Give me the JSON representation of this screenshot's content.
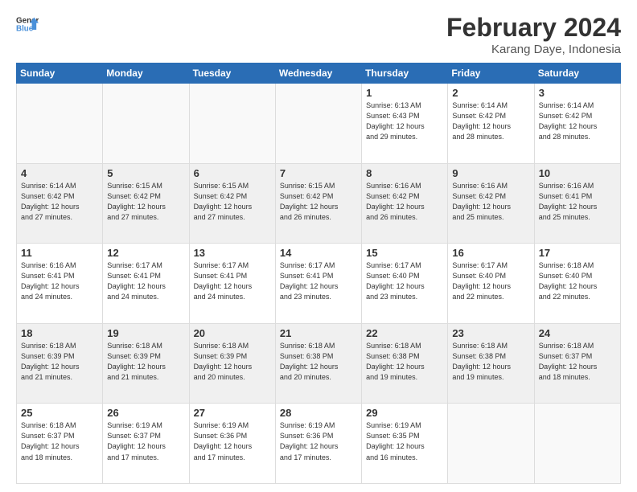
{
  "header": {
    "logo_general": "General",
    "logo_blue": "Blue",
    "month": "February 2024",
    "location": "Karang Daye, Indonesia"
  },
  "weekdays": [
    "Sunday",
    "Monday",
    "Tuesday",
    "Wednesday",
    "Thursday",
    "Friday",
    "Saturday"
  ],
  "rows": [
    {
      "shaded": false,
      "cells": [
        {
          "num": "",
          "info": ""
        },
        {
          "num": "",
          "info": ""
        },
        {
          "num": "",
          "info": ""
        },
        {
          "num": "",
          "info": ""
        },
        {
          "num": "1",
          "info": "Sunrise: 6:13 AM\nSunset: 6:43 PM\nDaylight: 12 hours\nand 29 minutes."
        },
        {
          "num": "2",
          "info": "Sunrise: 6:14 AM\nSunset: 6:42 PM\nDaylight: 12 hours\nand 28 minutes."
        },
        {
          "num": "3",
          "info": "Sunrise: 6:14 AM\nSunset: 6:42 PM\nDaylight: 12 hours\nand 28 minutes."
        }
      ]
    },
    {
      "shaded": true,
      "cells": [
        {
          "num": "4",
          "info": "Sunrise: 6:14 AM\nSunset: 6:42 PM\nDaylight: 12 hours\nand 27 minutes."
        },
        {
          "num": "5",
          "info": "Sunrise: 6:15 AM\nSunset: 6:42 PM\nDaylight: 12 hours\nand 27 minutes."
        },
        {
          "num": "6",
          "info": "Sunrise: 6:15 AM\nSunset: 6:42 PM\nDaylight: 12 hours\nand 27 minutes."
        },
        {
          "num": "7",
          "info": "Sunrise: 6:15 AM\nSunset: 6:42 PM\nDaylight: 12 hours\nand 26 minutes."
        },
        {
          "num": "8",
          "info": "Sunrise: 6:16 AM\nSunset: 6:42 PM\nDaylight: 12 hours\nand 26 minutes."
        },
        {
          "num": "9",
          "info": "Sunrise: 6:16 AM\nSunset: 6:42 PM\nDaylight: 12 hours\nand 25 minutes."
        },
        {
          "num": "10",
          "info": "Sunrise: 6:16 AM\nSunset: 6:41 PM\nDaylight: 12 hours\nand 25 minutes."
        }
      ]
    },
    {
      "shaded": false,
      "cells": [
        {
          "num": "11",
          "info": "Sunrise: 6:16 AM\nSunset: 6:41 PM\nDaylight: 12 hours\nand 24 minutes."
        },
        {
          "num": "12",
          "info": "Sunrise: 6:17 AM\nSunset: 6:41 PM\nDaylight: 12 hours\nand 24 minutes."
        },
        {
          "num": "13",
          "info": "Sunrise: 6:17 AM\nSunset: 6:41 PM\nDaylight: 12 hours\nand 24 minutes."
        },
        {
          "num": "14",
          "info": "Sunrise: 6:17 AM\nSunset: 6:41 PM\nDaylight: 12 hours\nand 23 minutes."
        },
        {
          "num": "15",
          "info": "Sunrise: 6:17 AM\nSunset: 6:40 PM\nDaylight: 12 hours\nand 23 minutes."
        },
        {
          "num": "16",
          "info": "Sunrise: 6:17 AM\nSunset: 6:40 PM\nDaylight: 12 hours\nand 22 minutes."
        },
        {
          "num": "17",
          "info": "Sunrise: 6:18 AM\nSunset: 6:40 PM\nDaylight: 12 hours\nand 22 minutes."
        }
      ]
    },
    {
      "shaded": true,
      "cells": [
        {
          "num": "18",
          "info": "Sunrise: 6:18 AM\nSunset: 6:39 PM\nDaylight: 12 hours\nand 21 minutes."
        },
        {
          "num": "19",
          "info": "Sunrise: 6:18 AM\nSunset: 6:39 PM\nDaylight: 12 hours\nand 21 minutes."
        },
        {
          "num": "20",
          "info": "Sunrise: 6:18 AM\nSunset: 6:39 PM\nDaylight: 12 hours\nand 20 minutes."
        },
        {
          "num": "21",
          "info": "Sunrise: 6:18 AM\nSunset: 6:38 PM\nDaylight: 12 hours\nand 20 minutes."
        },
        {
          "num": "22",
          "info": "Sunrise: 6:18 AM\nSunset: 6:38 PM\nDaylight: 12 hours\nand 19 minutes."
        },
        {
          "num": "23",
          "info": "Sunrise: 6:18 AM\nSunset: 6:38 PM\nDaylight: 12 hours\nand 19 minutes."
        },
        {
          "num": "24",
          "info": "Sunrise: 6:18 AM\nSunset: 6:37 PM\nDaylight: 12 hours\nand 18 minutes."
        }
      ]
    },
    {
      "shaded": false,
      "cells": [
        {
          "num": "25",
          "info": "Sunrise: 6:18 AM\nSunset: 6:37 PM\nDaylight: 12 hours\nand 18 minutes."
        },
        {
          "num": "26",
          "info": "Sunrise: 6:19 AM\nSunset: 6:37 PM\nDaylight: 12 hours\nand 17 minutes."
        },
        {
          "num": "27",
          "info": "Sunrise: 6:19 AM\nSunset: 6:36 PM\nDaylight: 12 hours\nand 17 minutes."
        },
        {
          "num": "28",
          "info": "Sunrise: 6:19 AM\nSunset: 6:36 PM\nDaylight: 12 hours\nand 17 minutes."
        },
        {
          "num": "29",
          "info": "Sunrise: 6:19 AM\nSunset: 6:35 PM\nDaylight: 12 hours\nand 16 minutes."
        },
        {
          "num": "",
          "info": ""
        },
        {
          "num": "",
          "info": ""
        }
      ]
    }
  ]
}
